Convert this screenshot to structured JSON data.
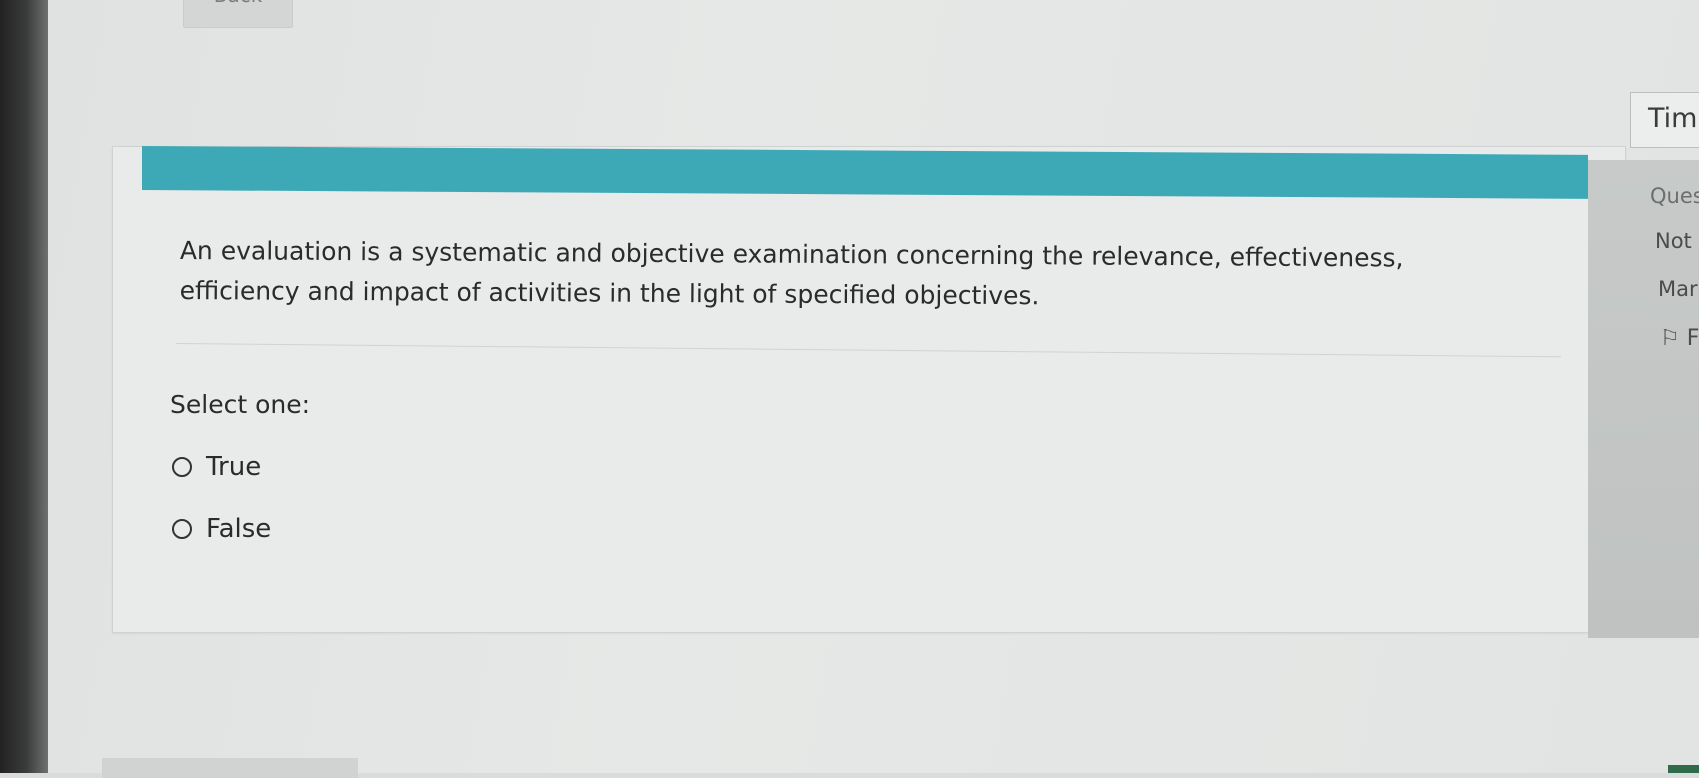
{
  "nav": {
    "back_label": "Back"
  },
  "question": {
    "text": "An evaluation is a systematic and objective examination concerning the relevance, effectiveness, efficiency and impact of activities in the light of specified objectives.",
    "select_prompt": "Select one:",
    "options": [
      {
        "label": "True",
        "selected": false
      },
      {
        "label": "False",
        "selected": false
      }
    ]
  },
  "sidebar": {
    "timer_label": "Tim",
    "question_label": "Ques",
    "status_label": "Not",
    "marks_label": "Mar",
    "flag_label": "F"
  },
  "colors": {
    "header_bar": "#3ea9b6",
    "card_background": "#e9ebea"
  }
}
